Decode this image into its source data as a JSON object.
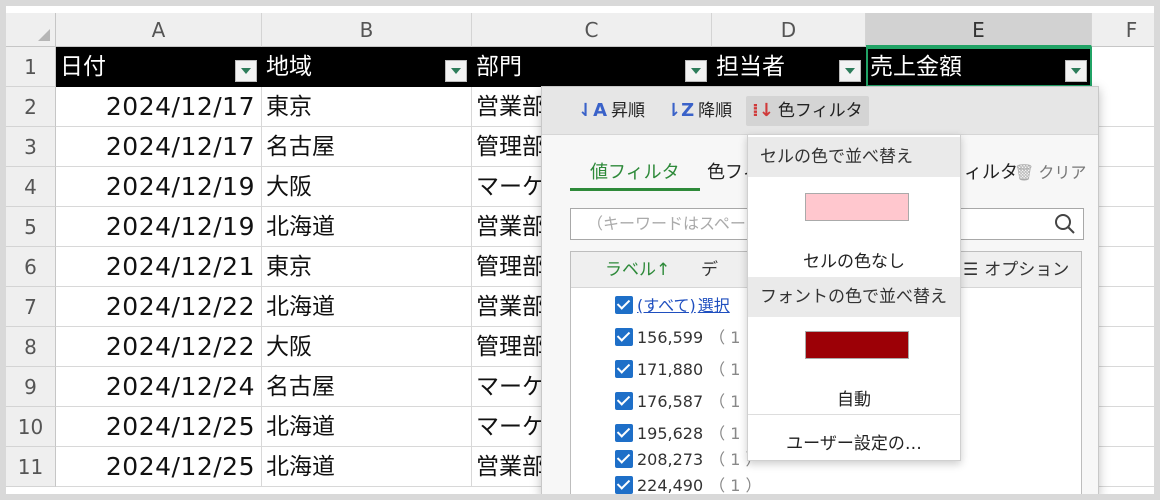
{
  "columns": [
    "A",
    "B",
    "C",
    "D",
    "E",
    "F"
  ],
  "headers": [
    "日付",
    "地域",
    "部門",
    "担当者",
    "売上金額"
  ],
  "rows": [
    {
      "num": "1"
    },
    {
      "num": "2",
      "date": "2024/12/17",
      "region": "東京",
      "dept": "営業部"
    },
    {
      "num": "3",
      "date": "2024/12/17",
      "region": "名古屋",
      "dept": "管理部"
    },
    {
      "num": "4",
      "date": "2024/12/19",
      "region": "大阪",
      "dept": "マーケ"
    },
    {
      "num": "5",
      "date": "2024/12/19",
      "region": "北海道",
      "dept": "営業部"
    },
    {
      "num": "6",
      "date": "2024/12/21",
      "region": "東京",
      "dept": "管理部"
    },
    {
      "num": "7",
      "date": "2024/12/22",
      "region": "北海道",
      "dept": "営業部"
    },
    {
      "num": "8",
      "date": "2024/12/22",
      "region": "大阪",
      "dept": "管理部"
    },
    {
      "num": "9",
      "date": "2024/12/24",
      "region": "名古屋",
      "dept": "マーケ"
    },
    {
      "num": "10",
      "date": "2024/12/25",
      "region": "北海道",
      "dept": "マーケ"
    },
    {
      "num": "11",
      "date": "2024/12/25",
      "region": "北海道",
      "dept": "営業部"
    }
  ],
  "filter_panel": {
    "sort_asc": "昇順",
    "sort_desc": "降順",
    "color_filter": "色フィルタ",
    "tab_value": "値フィルタ",
    "tab_color": "色フィ",
    "tab_filter_tail": "ィルタ",
    "clear": "クリア",
    "search_placeholder": "（キーワードはスペース",
    "col_label": "ラベル↑",
    "col_count": "デ",
    "col_options": "オプション",
    "select_all": "(すべて)",
    "select_sel": "選択",
    "items": [
      {
        "value": "156,599",
        "count": "（ 1"
      },
      {
        "value": "171,880",
        "count": "（ 1"
      },
      {
        "value": "176,587",
        "count": "（ 1"
      },
      {
        "value": "195,628",
        "count": "（ 1"
      },
      {
        "value": "208,273",
        "count": "（ 1 ）"
      },
      {
        "value": "224,490",
        "count": "（ 1 ）"
      }
    ]
  },
  "color_menu": {
    "cell_color_header": "セルの色で並べ替え",
    "cell_color_swatch": "#ffc7ce",
    "no_cell_color": "セルの色なし",
    "font_color_header": "フォントの色で並べ替え",
    "font_color_swatch": "#9c0006",
    "auto": "自動",
    "custom": "ユーザー設定の…"
  }
}
